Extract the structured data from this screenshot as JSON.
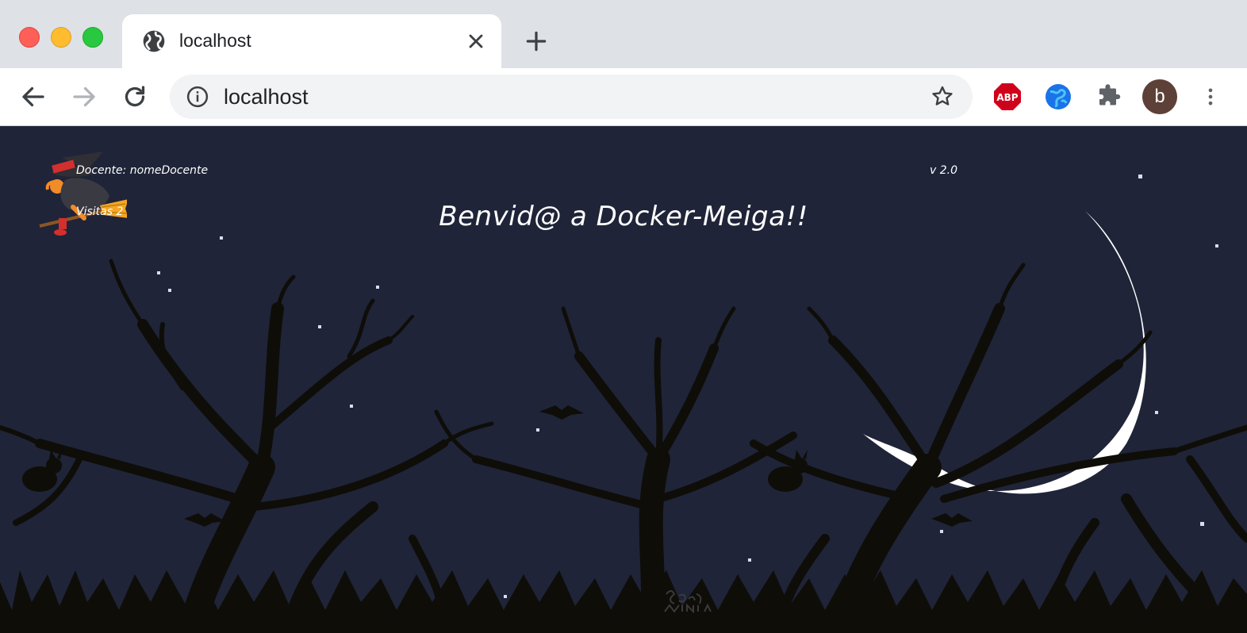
{
  "browser": {
    "tab": {
      "title": "localhost"
    },
    "address_bar": {
      "url": "localhost"
    },
    "extensions": {
      "abp_label": "ABP"
    },
    "profile": {
      "initial": "b",
      "color": "#5d4037"
    }
  },
  "page": {
    "docente_label": "Docente: nomeDocente",
    "visitas_label": "Visitas 2",
    "version": "v 2.0",
    "welcome_title": "Benvid@ a Docker-Meiga!!",
    "signature": "seco minha",
    "colors": {
      "sky": "#1f2438",
      "moon": "#ffffff",
      "silhouette": "#0e0d08"
    }
  }
}
